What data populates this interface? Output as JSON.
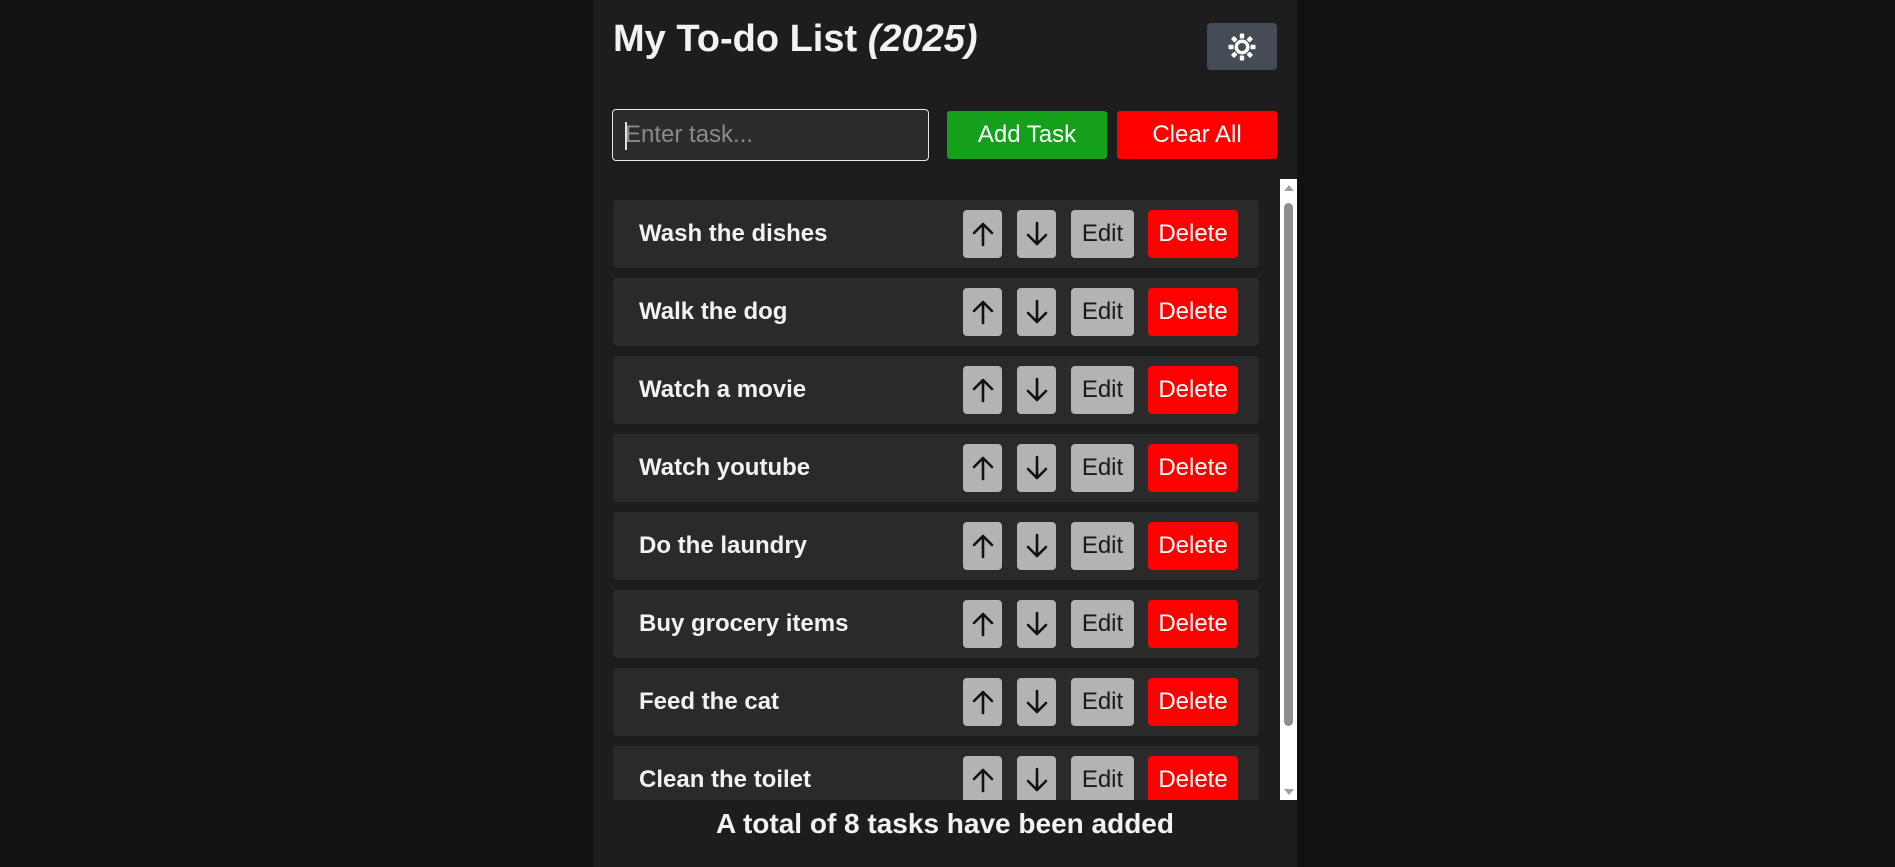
{
  "header": {
    "title": "My To-do List",
    "year": "(2025)",
    "theme_toggle_icon": "sun-icon"
  },
  "input": {
    "value": "",
    "placeholder": "Enter task..."
  },
  "buttons": {
    "add_label": "Add Task",
    "clear_label": "Clear All"
  },
  "task_actions": {
    "up_icon": "arrow-up-icon",
    "down_icon": "arrow-down-icon",
    "edit_label": "Edit",
    "delete_label": "Delete"
  },
  "tasks": [
    {
      "name": "Wash the dishes"
    },
    {
      "name": "Walk the dog"
    },
    {
      "name": "Watch a movie"
    },
    {
      "name": "Watch youtube"
    },
    {
      "name": "Do the laundry"
    },
    {
      "name": "Buy grocery items"
    },
    {
      "name": "Feed the cat"
    },
    {
      "name": "Clean the toilet"
    }
  ],
  "footer": {
    "summary": "A total of 8 tasks have been added"
  },
  "colors": {
    "page_background": "#111111",
    "panel_background": "#1d1d1d",
    "task_background": "#2a2a2a",
    "add_button": "#14a01a",
    "clear_button": "#ff0000",
    "delete_button": "#ff0000",
    "neutral_button": "#b3b3b3",
    "theme_button": "#454c55"
  }
}
